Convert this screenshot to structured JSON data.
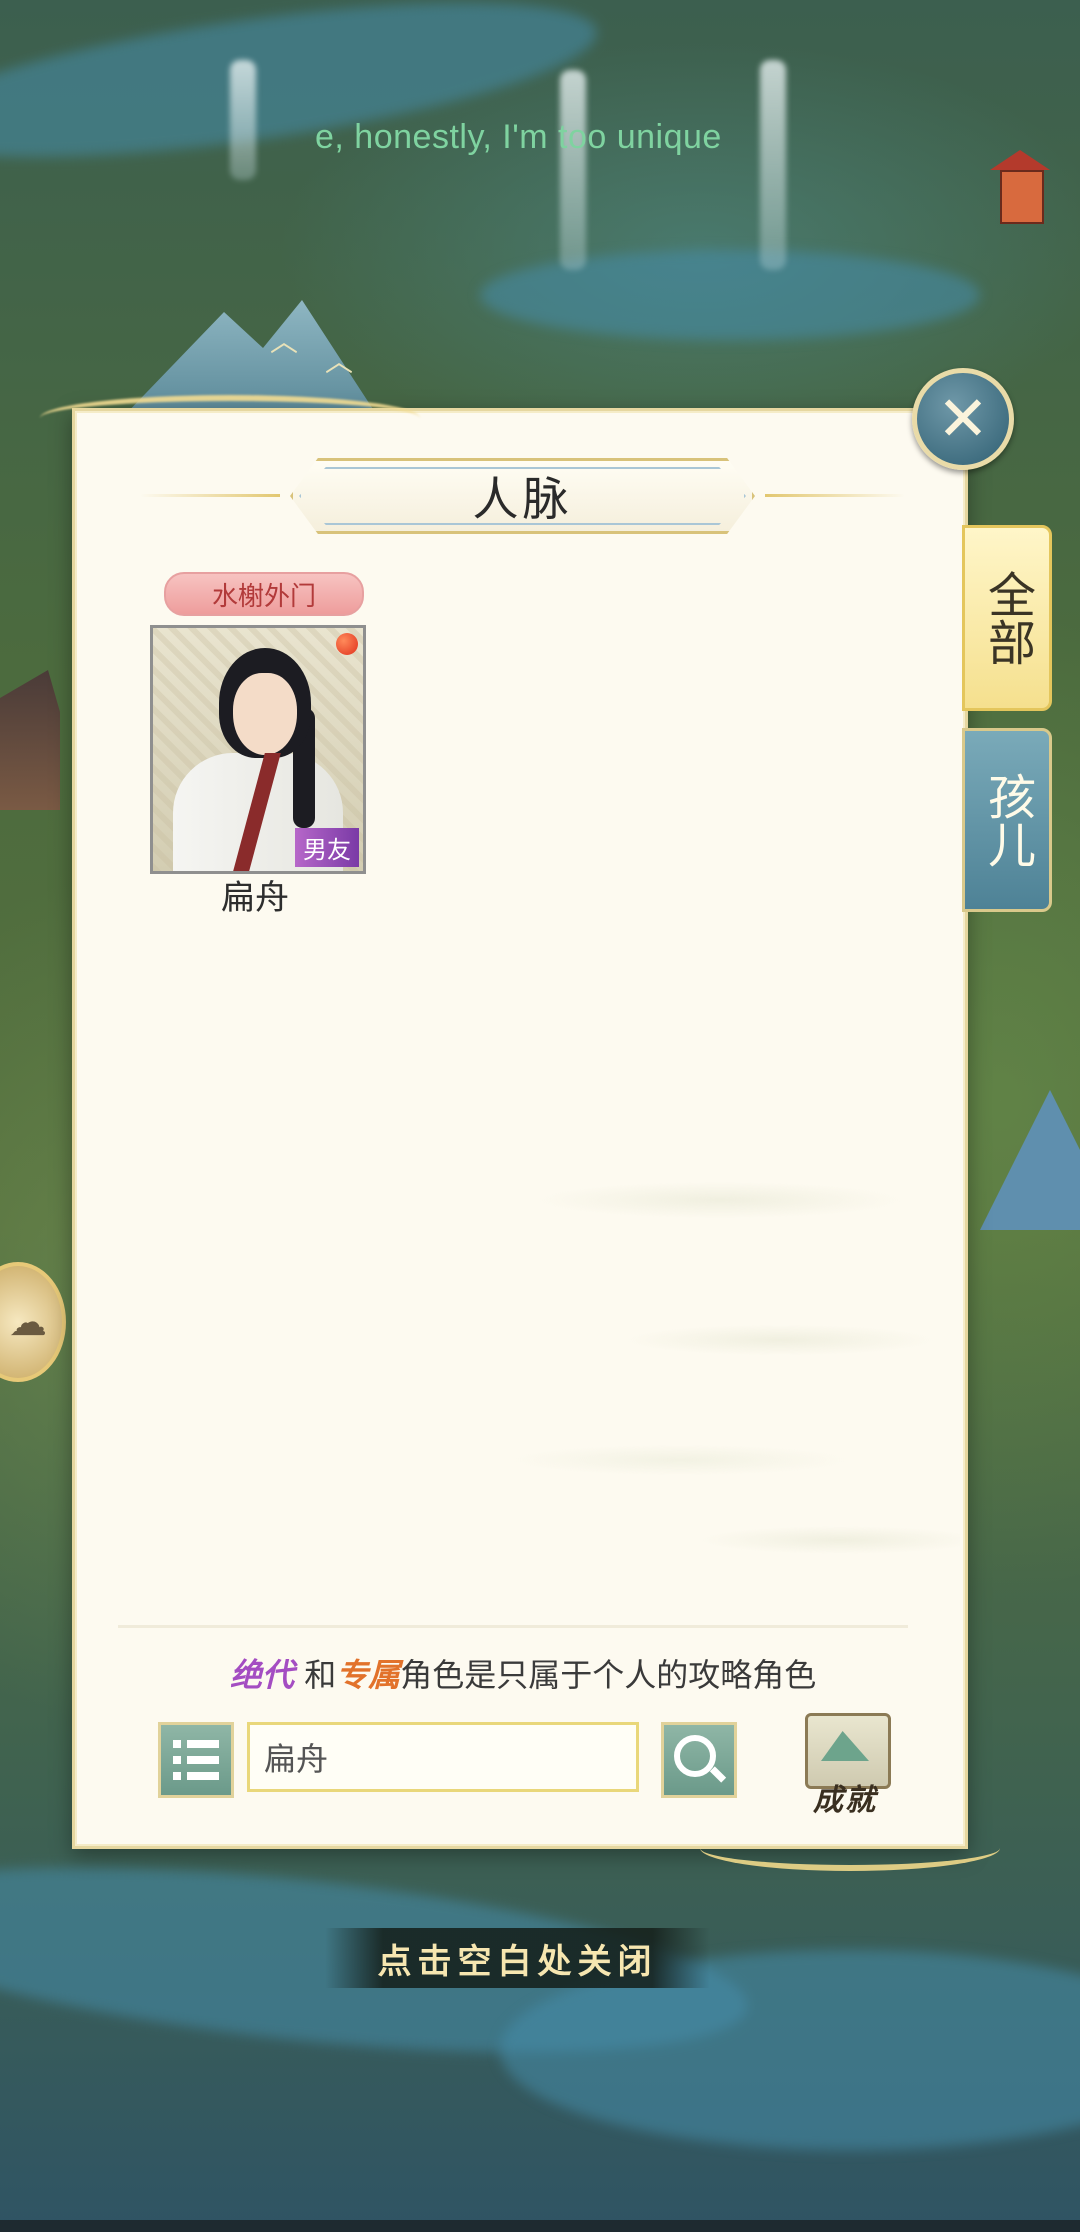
{
  "ticker": {
    "text": "e, honestly, I'm too unique"
  },
  "dialog": {
    "title": "人脉",
    "close_icon": "close-icon"
  },
  "tabs": [
    {
      "label": "全部",
      "selected": true
    },
    {
      "label": "孩儿",
      "selected": false
    }
  ],
  "characters": [
    {
      "faction": "水榭外门",
      "name": "扁舟",
      "relation_badge": "男友",
      "has_notification": true
    }
  ],
  "notice": {
    "rare": "绝代",
    "and": "和",
    "exclusive": "专属",
    "rest": "角色是只属于个人的攻略角色"
  },
  "search": {
    "value": "扁舟",
    "placeholder": "扁舟",
    "list_icon": "list-icon",
    "search_icon": "search-icon"
  },
  "achievements": {
    "label": "成就"
  },
  "dismiss_hint": "点击空白处关闭",
  "colors": {
    "panel_bg": "#fdfaf0",
    "tab_active": "#f5e08e",
    "tab_inactive": "#4e8296",
    "ticker": "#7fd3a0",
    "faction_tag": "#ee9d9c",
    "relation_badge": "#7a3aa6"
  }
}
